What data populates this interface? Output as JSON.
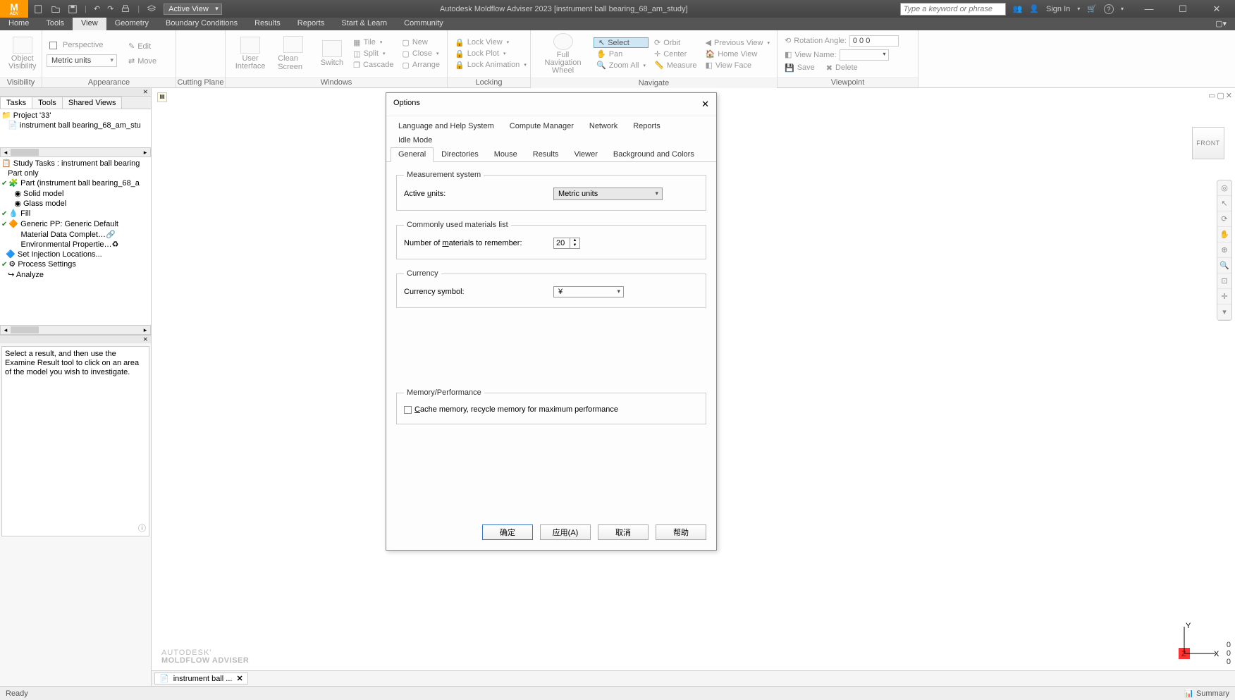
{
  "titlebar": {
    "active_view": "Active View",
    "app_title": "Autodesk Moldflow Adviser 2023      [instrument ball bearing_68_am_study]",
    "search_placeholder": "Type a keyword or phrase",
    "sign_in": "Sign In"
  },
  "menubar": [
    "Home",
    "Tools",
    "View",
    "Geometry",
    "Boundary Conditions",
    "Results",
    "Reports",
    "Start & Learn",
    "Community"
  ],
  "ribbon": {
    "visibility": {
      "object_vis": "Object\nVisibility",
      "label": "Visibility"
    },
    "appearance": {
      "perspective": "Perspective",
      "units": "Metric units",
      "edit": "Edit",
      "move": "Move",
      "label": "Appearance"
    },
    "cutting": {
      "label": "Cutting Plane"
    },
    "windows": {
      "user_interface": "User\nInterface",
      "clean": "Clean Screen",
      "switch": "Switch",
      "tile": "Tile",
      "split": "Split",
      "cascade": "Cascade",
      "new": "New",
      "close": "Close",
      "arrange": "Arrange",
      "label": "Windows"
    },
    "locking": {
      "lock_view": "Lock View",
      "lock_plot": "Lock Plot",
      "lock_anim": "Lock Animation",
      "label": "Locking"
    },
    "navigate": {
      "nav_wheel": "Full Navigation\nWheel",
      "select": "Select",
      "pan": "Pan",
      "zoom_all": "Zoom All",
      "orbit": "Orbit",
      "center": "Center",
      "measure": "Measure",
      "prev_view": "Previous View",
      "home_view": "Home View",
      "view_face": "View Face",
      "label": "Navigate"
    },
    "viewpoint": {
      "rot_angle": "Rotation Angle:",
      "rot_val": "0 0 0",
      "view_name": "View Name:",
      "save": "Save",
      "delete": "Delete",
      "label": "Viewpoint"
    }
  },
  "left": {
    "tabs": [
      "Tasks",
      "Tools",
      "Shared Views"
    ],
    "project": "Project '33'",
    "study": "instrument ball bearing_68_am_stu",
    "study_tasks_hdr": "Study Tasks : instrument ball bearing",
    "part_only": "Part only",
    "part": "Part (instrument ball bearing_68_a",
    "solid": "Solid model",
    "glass": "Glass model",
    "fill": "Fill",
    "generic": "Generic PP: Generic Default",
    "mat_data": "Material Data Complet…",
    "env_prop": "Environmental Propertie…",
    "set_inj": "Set Injection Locations...",
    "proc_set": "Process Settings",
    "analyze": "Analyze",
    "info_text": "Select a result, and then use the Examine Result tool to click on an area of the model you wish to investigate."
  },
  "canvas": {
    "front": "FRONT",
    "watermark_line1": "AUTODESK'",
    "watermark_line2": "MOLDFLOW ADVISER",
    "doctab": "instrument ball ...",
    "axis": {
      "x": "X",
      "y": "Y",
      "z": "Z"
    },
    "coords": [
      "0",
      "0",
      "0"
    ]
  },
  "dialog": {
    "title": "Options",
    "tabs_row1": [
      "Language and Help System",
      "Compute Manager",
      "Network",
      "Reports",
      "Idle Mode"
    ],
    "tabs_row2": [
      "General",
      "Directories",
      "Mouse",
      "Results",
      "Viewer",
      "Background and Colors"
    ],
    "active_tab": "General",
    "fs_measurement": "Measurement system",
    "active_units_label": "Active units:",
    "active_units_value": "Metric units",
    "fs_materials": "Commonly used materials list",
    "materials_label": "Number of materials to remember:",
    "materials_value": "20",
    "fs_currency": "Currency",
    "currency_label": "Currency symbol:",
    "currency_value": "¥",
    "fs_memory": "Memory/Performance",
    "cache_label": "Cache memory, recycle memory for maximum performance",
    "cache_checked": false,
    "btn_ok": "确定",
    "btn_apply": "应用(A)",
    "btn_cancel": "取消",
    "btn_help": "帮助"
  },
  "status": {
    "ready": "Ready",
    "summary": "Summary"
  }
}
